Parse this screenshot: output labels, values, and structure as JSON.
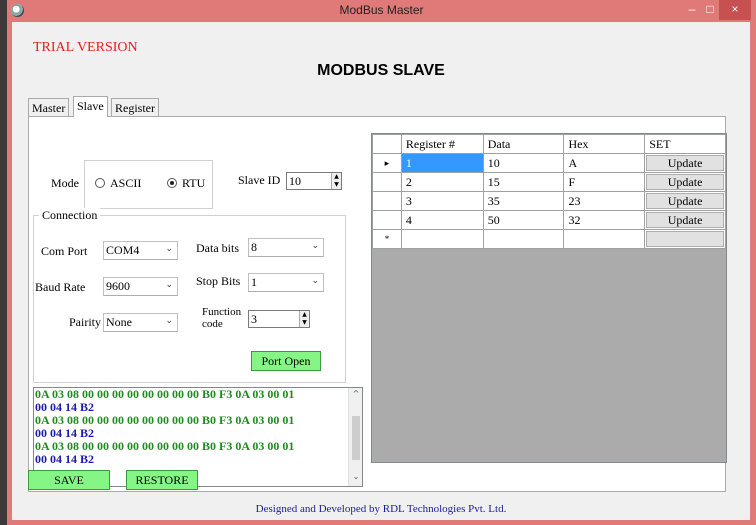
{
  "window": {
    "title": "ModBus Master",
    "controls": {
      "minimize": "–",
      "maximize": "□",
      "close": "×"
    }
  },
  "header": {
    "trial": "TRIAL VERSION",
    "main_title": "MODBUS SLAVE"
  },
  "tabs": [
    {
      "label": "Master"
    },
    {
      "label": "Slave",
      "active": true
    },
    {
      "label": "Register"
    }
  ],
  "mode": {
    "label": "Mode",
    "options": [
      {
        "label": "ASCII",
        "selected": false
      },
      {
        "label": "RTU",
        "selected": true
      }
    ],
    "slave_id_label": "Slave ID",
    "slave_id_value": "10"
  },
  "connection": {
    "title": "Connection",
    "com_port_label": "Com Port",
    "com_port_value": "COM4",
    "data_bits_label": "Data bits",
    "data_bits_value": "8",
    "baud_rate_label": "Baud Rate",
    "baud_rate_value": "9600",
    "stop_bits_label": "Stop Bits",
    "stop_bits_value": "1",
    "parity_label": "Pairity",
    "parity_value": "None",
    "function_code_label_1": "Function",
    "function_code_label_2": "code",
    "function_code_value": "3",
    "port_button": "Port Open"
  },
  "log": [
    {
      "text": "0A 03 08 00 00 00 00 00 00 00 00 B0 F3 0A 03 00 01",
      "color": "green"
    },
    {
      "text": "00 04 14 B2",
      "color": "blue"
    },
    {
      "text": "0A 03 08 00 00 00 00 00 00 00 00 B0 F3 0A 03 00 01",
      "color": "green"
    },
    {
      "text": "00 04 14 B2",
      "color": "blue"
    },
    {
      "text": "0A 03 08 00 00 00 00 00 00 00 00 B0 F3 0A 03 00 01",
      "color": "green"
    },
    {
      "text": "00 04 14 B2",
      "color": "blue"
    }
  ],
  "table": {
    "headers": [
      "Register #",
      "Data",
      "Hex",
      "SET"
    ],
    "rows": [
      {
        "register": "1",
        "data": "10",
        "hex": "A",
        "set": "Update"
      },
      {
        "register": "2",
        "data": "15",
        "hex": "F",
        "set": "Update"
      },
      {
        "register": "3",
        "data": "35",
        "hex": "23",
        "set": "Update"
      },
      {
        "register": "4",
        "data": "50",
        "hex": "32",
        "set": "Update"
      }
    ],
    "new_row_marker": "*",
    "current_row_marker": "▸"
  },
  "buttons": {
    "save": "SAVE",
    "restore": "RESTORE"
  },
  "footer": "Designed and Developed by RDL Technologies Pvt. Ltd.",
  "colors": {
    "titlebar": "#e07a78",
    "accent_green": "#85f585",
    "log_green": "#1f8a1f",
    "log_blue": "#1a1ab0",
    "trial_red": "#e0201e"
  }
}
